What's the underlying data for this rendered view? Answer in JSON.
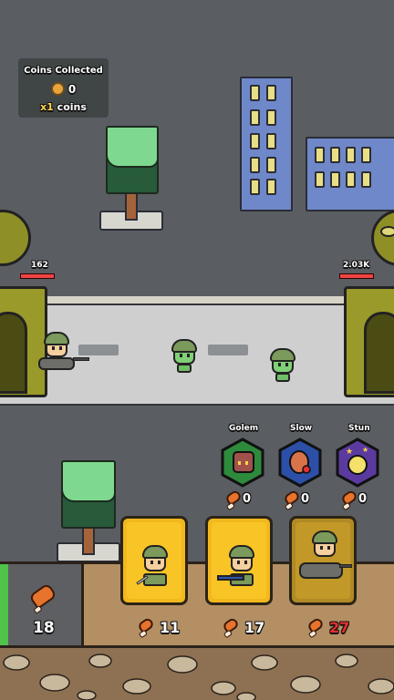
{
  "coins_panel": {
    "title": "Coins Collected",
    "count": "0",
    "multiplier_prefix": "x1",
    "multiplier_suffix": "coins"
  },
  "player_base": {
    "hp": "162"
  },
  "enemy_base": {
    "hp": "2.03K"
  },
  "abilities": [
    {
      "label": "Golem",
      "count": "0",
      "color": "#2e8a3c",
      "icon": "golem-icon"
    },
    {
      "label": "Slow",
      "count": "0",
      "color": "#2c50a8",
      "icon": "slow-icon"
    },
    {
      "label": "Stun",
      "count": "0",
      "color": "#5b3aa0",
      "icon": "stun-icon"
    }
  ],
  "meat_resource": {
    "amount": "18",
    "icon": "meat-icon"
  },
  "unit_cards": [
    {
      "name": "knife-soldier",
      "cost": "11",
      "affordable": true
    },
    {
      "name": "rifle-soldier",
      "cost": "17",
      "affordable": true
    },
    {
      "name": "tank-soldier",
      "cost": "27",
      "affordable": false
    }
  ],
  "colors": {
    "card_gold": "#f2b81e",
    "card_locked": "#b08a24",
    "cost_red": "#e43030",
    "base_olive": "#9a9a2a"
  }
}
